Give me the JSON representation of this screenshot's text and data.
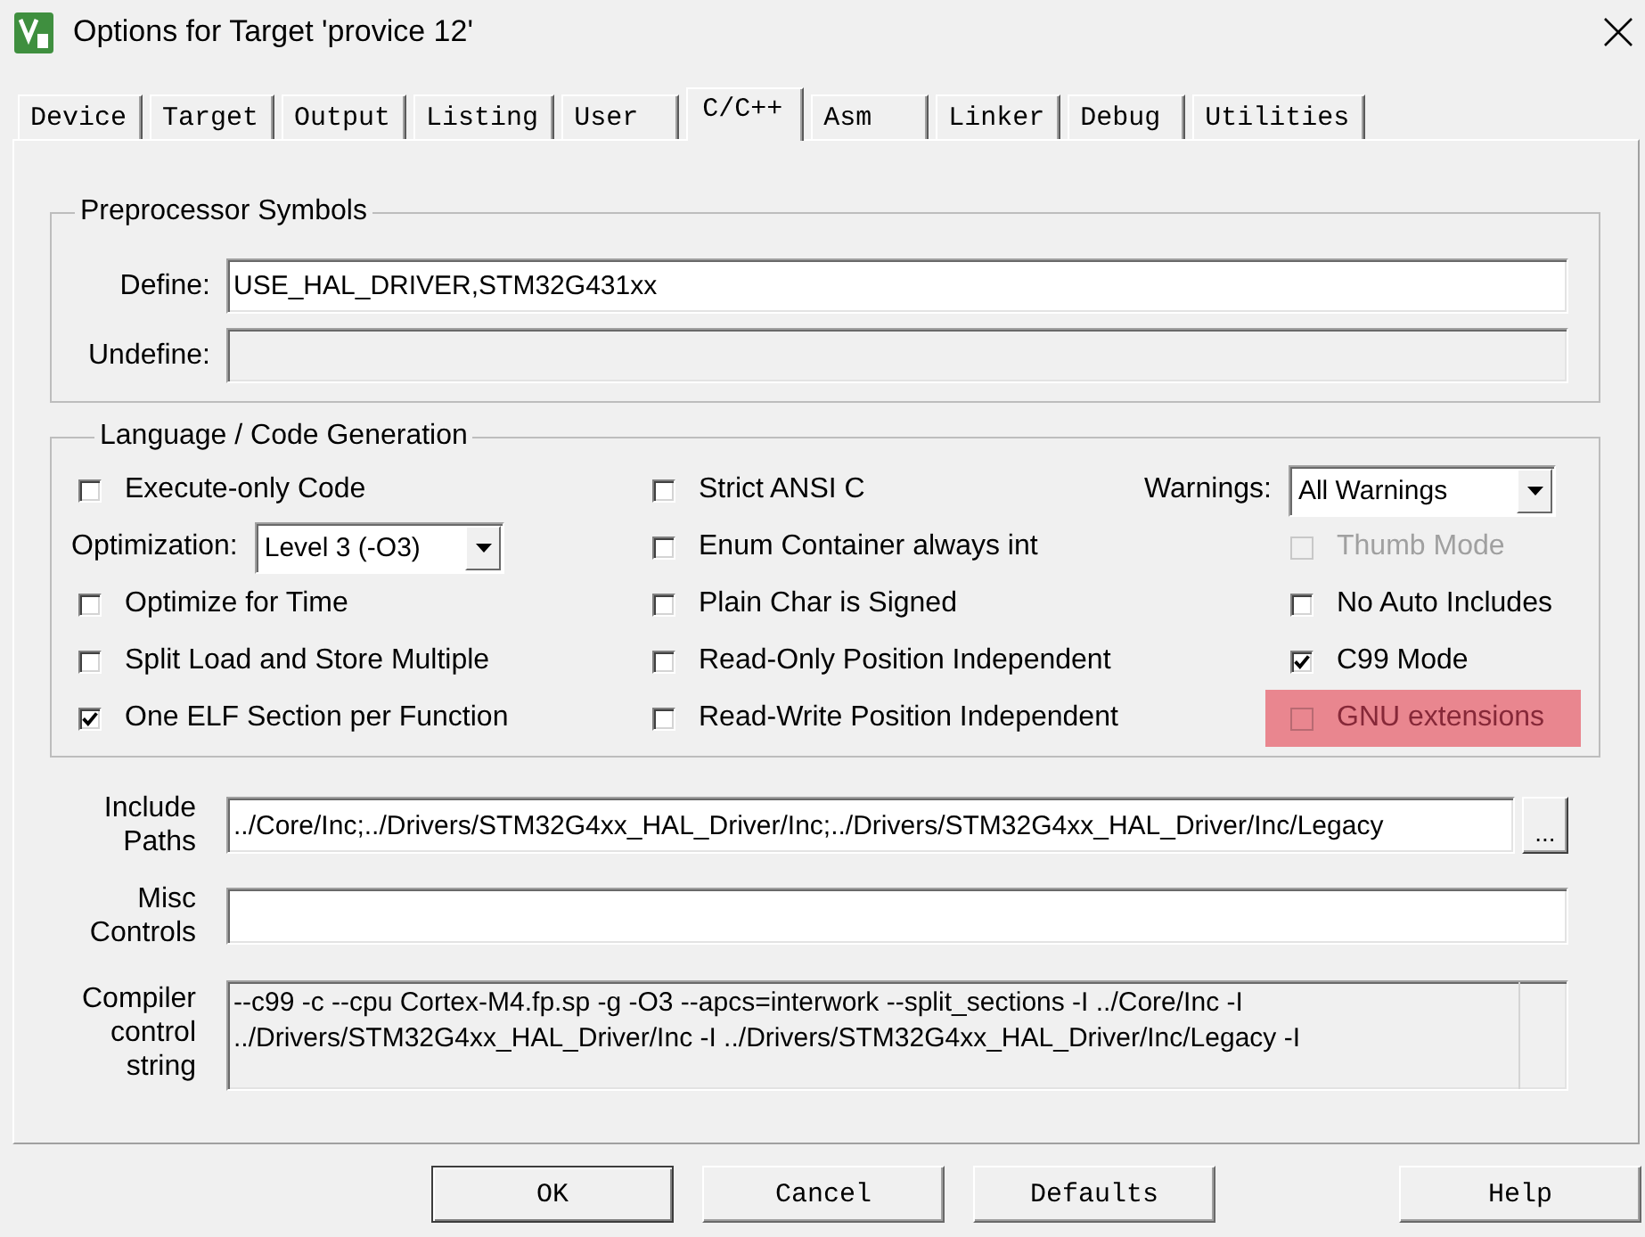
{
  "window": {
    "title": "Options for Target 'provice 12'"
  },
  "tabs": [
    {
      "label": "Device",
      "selected": false
    },
    {
      "label": "Target",
      "selected": false
    },
    {
      "label": "Output",
      "selected": false
    },
    {
      "label": "Listing",
      "selected": false
    },
    {
      "label": "User",
      "selected": false
    },
    {
      "label": "C/C++",
      "selected": true
    },
    {
      "label": "Asm",
      "selected": false
    },
    {
      "label": "Linker",
      "selected": false
    },
    {
      "label": "Debug",
      "selected": false
    },
    {
      "label": "Utilities",
      "selected": false
    }
  ],
  "preprocessor": {
    "title": "Preprocessor Symbols",
    "fields": [
      {
        "label": "Define:",
        "value": "USE_HAL_DRIVER,STM32G431xx",
        "disabled": false
      },
      {
        "label": "Undefine:",
        "disabled": true
      }
    ]
  },
  "code_generation": {
    "title": "Language / Code Generation",
    "columns": [
      {
        "items": [
          {
            "kind": "checkbox",
            "label": "Execute-only Code",
            "checked": false,
            "disabled": false,
            "highlighted": false
          },
          {
            "kind": "dropdown",
            "label": "Optimization:",
            "value": "Level 3 (-O3)"
          },
          {
            "kind": "checkbox",
            "label": "Optimize for Time",
            "checked": false,
            "disabled": false,
            "highlighted": false
          },
          {
            "kind": "checkbox",
            "label": "Split Load and Store Multiple",
            "checked": false,
            "disabled": false,
            "highlighted": false
          },
          {
            "kind": "checkbox",
            "label": "One ELF Section per Function",
            "checked": true,
            "disabled": false,
            "highlighted": false
          }
        ]
      },
      {
        "items": [
          {
            "kind": "checkbox",
            "label": "Strict ANSI C",
            "checked": false,
            "disabled": false,
            "highlighted": false
          },
          {
            "kind": "checkbox",
            "label": "Enum Container always int",
            "checked": false,
            "disabled": false,
            "highlighted": false
          },
          {
            "kind": "checkbox",
            "label": "Plain Char is Signed",
            "checked": false,
            "disabled": false,
            "highlighted": false
          },
          {
            "kind": "checkbox",
            "label": "Read-Only Position Independent",
            "checked": false,
            "disabled": false,
            "highlighted": false
          },
          {
            "kind": "checkbox",
            "label": "Read-Write Position Independent",
            "checked": false,
            "disabled": false,
            "highlighted": false
          }
        ]
      },
      {
        "items": [
          {
            "kind": "dropdown",
            "label": "Warnings:",
            "value": "All Warnings"
          },
          {
            "kind": "checkbox",
            "label": "Thumb Mode",
            "checked": false,
            "disabled": true,
            "highlighted": false
          },
          {
            "kind": "checkbox",
            "label": "No Auto Includes",
            "checked": false,
            "disabled": false,
            "highlighted": false
          },
          {
            "kind": "checkbox",
            "label": "C99 Mode",
            "checked": true,
            "disabled": false,
            "highlighted": false
          },
          {
            "kind": "checkbox",
            "label": "GNU extensions",
            "checked": false,
            "disabled": false,
            "highlighted": true
          }
        ]
      }
    ]
  },
  "compiler_fields": [
    {
      "kind": "line",
      "label": "Include Paths",
      "value": "../Core/Inc;../Drivers/STM32G4xx_HAL_Driver/Inc;../Drivers/STM32G4xx_HAL_Driver/Inc/Legacy",
      "disabled": false,
      "browse_label": "..."
    },
    {
      "kind": "line",
      "label": "Misc Controls",
      "disabled": false
    },
    {
      "kind": "text_area",
      "label": "Compiler control string",
      "value": "--c99 -c --cpu Cortex-M4.fp.sp -g -O3 --apcs=interwork --split_sections -I ../Core/Inc -I\n../Drivers/STM32G4xx_HAL_Driver/Inc -I ../Drivers/STM32G4xx_HAL_Driver/Inc/Legacy -I",
      "disabled": true
    }
  ],
  "buttons": [
    {
      "label": "OK",
      "default": true
    },
    {
      "label": "Cancel",
      "default": false
    },
    {
      "label": "Defaults",
      "default": false
    },
    {
      "label": "Help",
      "default": false
    }
  ]
}
